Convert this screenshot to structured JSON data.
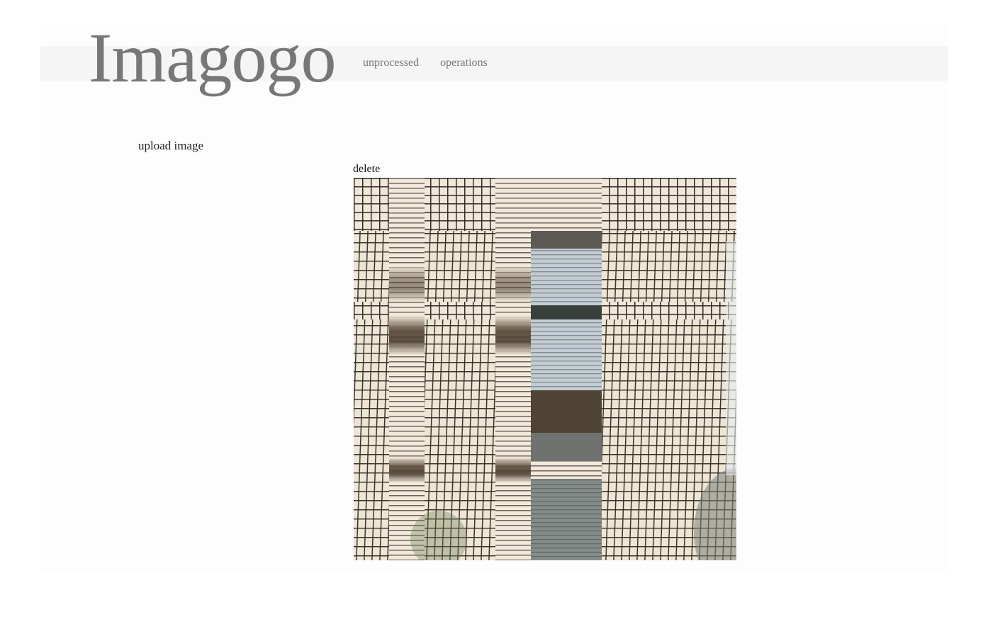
{
  "app": {
    "logo": "Imagogo"
  },
  "nav": {
    "items": [
      "unprocessed",
      "operations"
    ]
  },
  "actions": {
    "upload_label": "upload image",
    "delete_label": "delete"
  },
  "image": {
    "description_icon": "processed-glitch-image",
    "colors": {
      "base": "#eee5d6",
      "grid_line": "#2e2c26",
      "dark_band": "#4a3e30",
      "blue_band": "#b9c4cc",
      "grey_band": "#7f8583"
    }
  }
}
